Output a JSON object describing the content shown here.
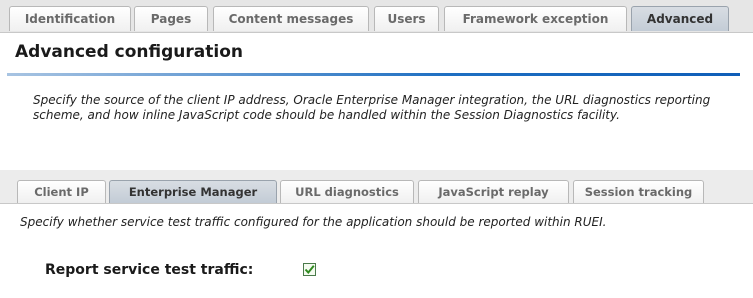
{
  "top_tabs": [
    "Identification",
    "Pages",
    "Content messages",
    "Users",
    "Framework exception",
    "Advanced"
  ],
  "top_tabs_active": "Advanced",
  "page": {
    "title": "Advanced configuration",
    "description": "Specify the source of the client IP address, Oracle Enterprise Manager integration, the URL diagnostics reporting scheme, and how inline JavaScript code should be handled within the Session Diagnostics facility."
  },
  "sub_tabs": [
    "Client IP",
    "Enterprise Manager",
    "URL diagnostics",
    "JavaScript replay",
    "Session tracking"
  ],
  "sub_tabs_active": "Enterprise Manager",
  "enterprise_manager": {
    "description": "Specify whether service test traffic configured for the application should be reported within RUEI.",
    "report_label": "Report service test traffic:",
    "report_checked": true
  },
  "colors": {
    "title_rule": "#1e6fc2",
    "active_tab": "#c3ccd6",
    "checkmark": "#2f8a1f"
  },
  "icons": {
    "checkbox": "checkmark-icon"
  }
}
